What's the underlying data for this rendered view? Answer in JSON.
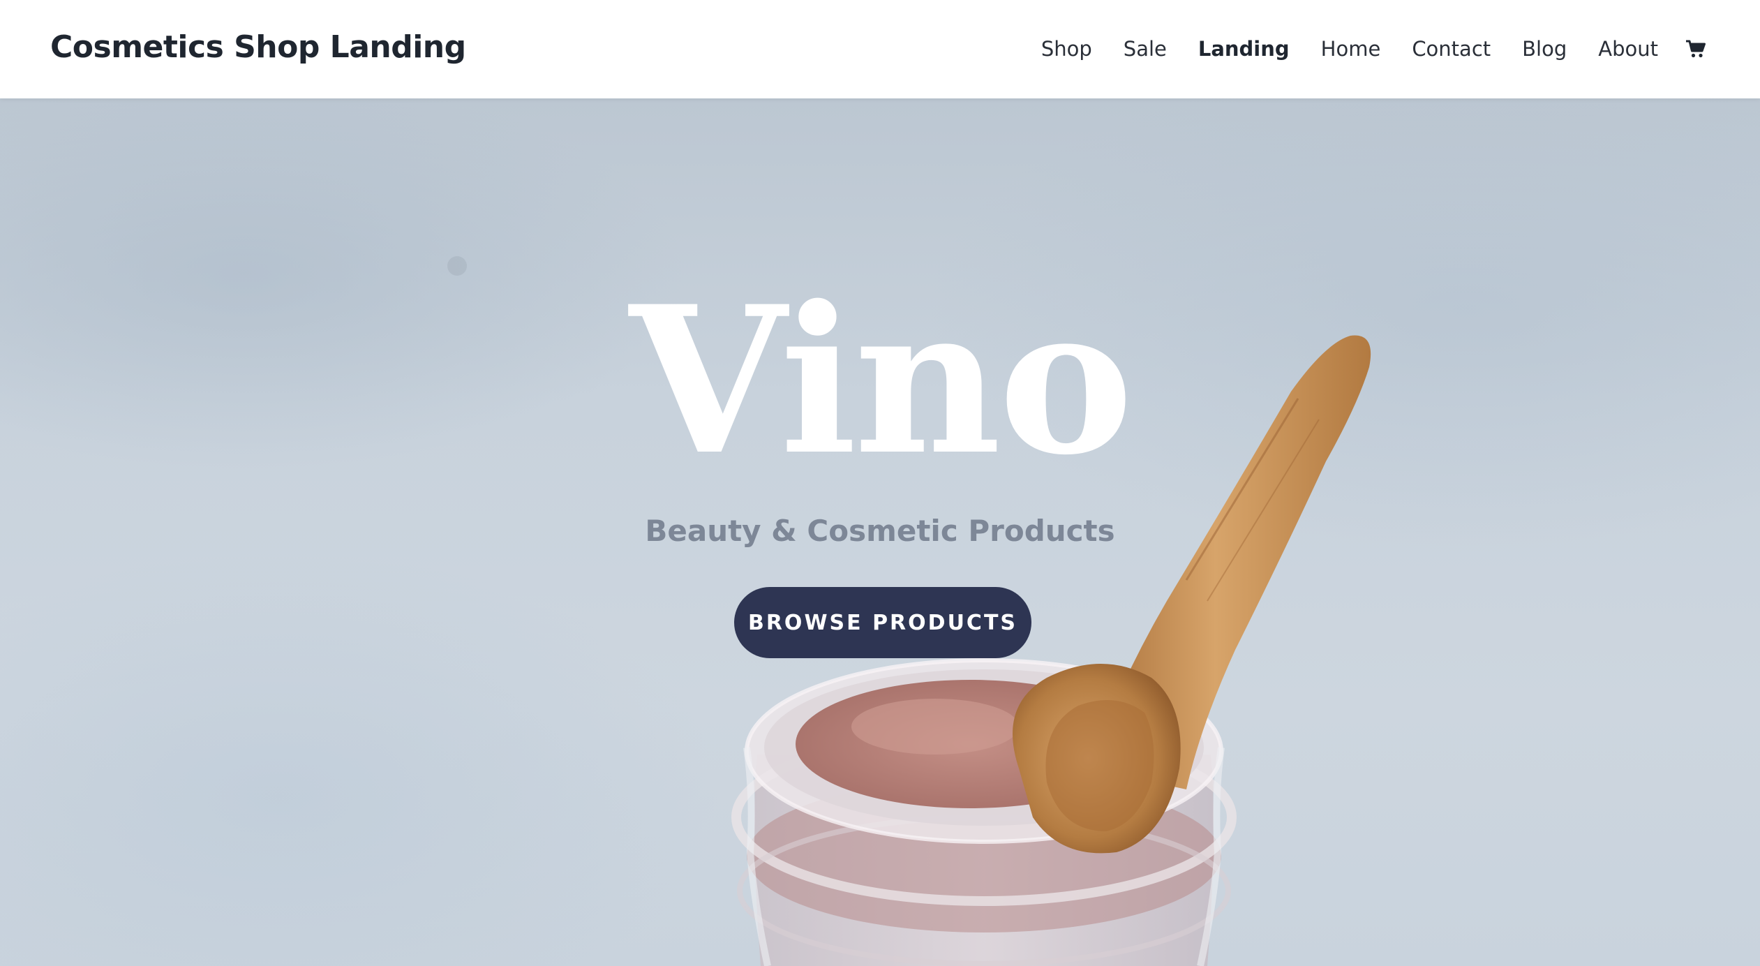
{
  "header": {
    "site_title": "Cosmetics Shop Landing",
    "nav": [
      {
        "label": "Shop",
        "active": false
      },
      {
        "label": "Sale",
        "active": false
      },
      {
        "label": "Landing",
        "active": true
      },
      {
        "label": "Home",
        "active": false
      },
      {
        "label": "Contact",
        "active": false
      },
      {
        "label": "Blog",
        "active": false
      },
      {
        "label": "About",
        "active": false
      }
    ],
    "cart_icon": "shopping-cart-icon"
  },
  "hero": {
    "heading": "Vino",
    "subtitle": "Beauty & Cosmetic Products",
    "button_label": "BROWSE PRODUCTS",
    "image_subject": "glass jar of pink clay powder with wooden spoon"
  },
  "colors": {
    "header_background": "#ffffff",
    "title_text": "#1f2630",
    "hero_background": "#c8d2dc",
    "heading_text": "#ffffff",
    "subtitle_text": "#7d8797",
    "button_background": "#2e3553",
    "button_text": "#ffffff"
  }
}
